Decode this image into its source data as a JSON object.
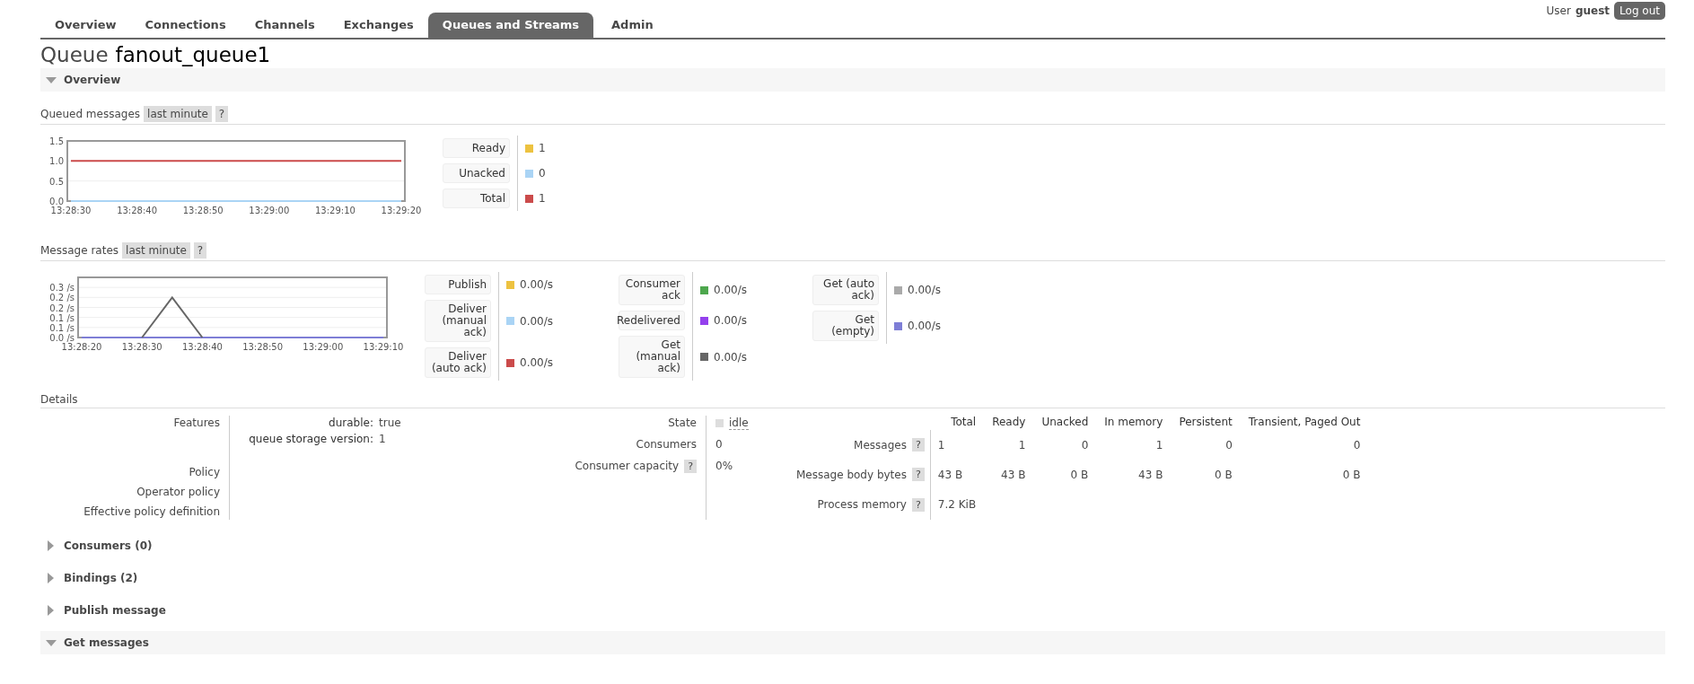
{
  "user": {
    "label": "User",
    "name": "guest",
    "logout": "Log out"
  },
  "tabs": [
    {
      "label": "Overview",
      "selected": false
    },
    {
      "label": "Connections",
      "selected": false
    },
    {
      "label": "Channels",
      "selected": false
    },
    {
      "label": "Exchanges",
      "selected": false
    },
    {
      "label": "Queues and Streams",
      "selected": true
    },
    {
      "label": "Admin",
      "selected": false
    }
  ],
  "title": {
    "prefix": "Queue",
    "name": "fanout_queue1"
  },
  "overview": {
    "title": "Overview",
    "expanded": true
  },
  "queued_messages": {
    "title": "Queued messages",
    "range": "last minute",
    "help": "?",
    "chart_data": {
      "type": "line",
      "categories": [
        "13:28:30",
        "13:28:40",
        "13:28:50",
        "13:29:00",
        "13:29:10",
        "13:29:20"
      ],
      "ylim": [
        0,
        1.5
      ],
      "yticks": [
        {
          "value": 0,
          "label": "0.0"
        },
        {
          "value": 0.5,
          "label": "0.5"
        },
        {
          "value": 1,
          "label": "1.0"
        },
        {
          "value": 1.5,
          "label": "1.5"
        }
      ],
      "grid": true,
      "series": [
        {
          "name": "Ready",
          "color": "#edc240",
          "values": [
            null,
            null,
            null,
            null,
            null,
            null
          ]
        },
        {
          "name": "Unacked",
          "color": "#aad4f5",
          "values": [
            0,
            0,
            0,
            0,
            0,
            0
          ]
        },
        {
          "name": "Total",
          "color": "#cb4b4b",
          "values": [
            1,
            1,
            1,
            1,
            1,
            1
          ]
        }
      ]
    },
    "legend_columns": [
      [
        {
          "value": "1"
        },
        {
          "value": "0"
        },
        {
          "value": "1"
        }
      ]
    ]
  },
  "message_rates": {
    "title": "Message rates",
    "range": "last minute",
    "help": "?",
    "chart_data": {
      "type": "line",
      "categories": [
        "13:28:20",
        null,
        "13:28:30",
        null,
        "13:28:40",
        null,
        "13:28:50",
        null,
        "13:29:00",
        null,
        "13:29:10"
      ],
      "ylim": [
        0,
        0.3
      ],
      "yticks": [
        {
          "value": 0,
          "label": "0.0 /s"
        },
        {
          "value": 0.05,
          "label": "0.1 /s"
        },
        {
          "value": 0.1,
          "label": "0.1 /s"
        },
        {
          "value": 0.15,
          "label": "0.2 /s"
        },
        {
          "value": 0.2,
          "label": "0.2 /s"
        },
        {
          "value": 0.25,
          "label": "0.3 /s"
        }
      ],
      "grid": true,
      "series": [
        {
          "name": "Publish",
          "color": "#edc240",
          "values": [
            null,
            null,
            null,
            null,
            null,
            null,
            null,
            null,
            null,
            null,
            null
          ]
        },
        {
          "name": "Deliver (manual ack)",
          "color": "#aad4f5",
          "values": [
            null,
            null,
            null,
            null,
            null,
            null,
            null,
            null,
            null,
            null,
            null
          ]
        },
        {
          "name": "Deliver (auto ack)",
          "color": "#cb4b4b",
          "values": [
            null,
            null,
            null,
            null,
            null,
            null,
            null,
            null,
            null,
            null,
            null
          ]
        },
        {
          "name": "Consumer ack",
          "color": "#4da74d",
          "values": [
            null,
            null,
            null,
            null,
            null,
            null,
            null,
            null,
            null,
            null,
            null
          ]
        },
        {
          "name": "Redelivered",
          "color": "#9440ed",
          "values": [
            null,
            null,
            null,
            null,
            null,
            null,
            null,
            null,
            null,
            null,
            null
          ]
        },
        {
          "name": "Get (manual ack)",
          "color": "#666666",
          "values": [
            null,
            null,
            0,
            0.2,
            0,
            null,
            null,
            null,
            null,
            null,
            null
          ]
        },
        {
          "name": "Get (auto ack)",
          "color": "#aaaaaa",
          "values": [
            null,
            null,
            null,
            null,
            null,
            null,
            null,
            null,
            null,
            null,
            null
          ]
        },
        {
          "name": "Get (empty)",
          "color": "#7e7ed6",
          "values": [
            0,
            0,
            0,
            0,
            0,
            0,
            0,
            0,
            0,
            0,
            0
          ]
        }
      ]
    },
    "legend_columns": [
      [
        {
          "value": "0.00/s"
        },
        {
          "value": "0.00/s"
        },
        {
          "value": "0.00/s"
        }
      ],
      [
        {
          "value": "0.00/s"
        },
        {
          "value": "0.00/s"
        },
        {
          "value": "0.00/s"
        }
      ],
      [
        {
          "value": "0.00/s"
        },
        {
          "value": "0.00/s"
        }
      ]
    ]
  },
  "details": {
    "title": "Details",
    "features_label": "Features",
    "features": [
      {
        "key": "durable:",
        "value": "true"
      },
      {
        "key": "queue storage version:",
        "value": "1"
      }
    ],
    "policy_labels": [
      "Policy",
      "Operator policy",
      "Effective policy definition"
    ],
    "state": {
      "label": "State",
      "value": "idle"
    },
    "consumers": {
      "label": "Consumers",
      "value": "0"
    },
    "capacity": {
      "label": "Consumer capacity",
      "help": "?",
      "value": "0%"
    },
    "columns": [
      "Total",
      "Ready",
      "Unacked",
      "In memory",
      "Persistent",
      "Transient, Paged Out"
    ],
    "rows": [
      {
        "label": "Messages",
        "help": "?",
        "cells": [
          "1",
          "1",
          "0",
          "1",
          "0",
          "0"
        ]
      },
      {
        "label": "Message body bytes",
        "help": "?",
        "cells": [
          "43 B",
          "43 B",
          "0 B",
          "43 B",
          "0 B",
          "0 B"
        ]
      },
      {
        "label": "Process memory",
        "help": "?",
        "cells": [
          "7.2 KiB"
        ]
      }
    ]
  },
  "sections": [
    {
      "title": "Consumers (0)",
      "expanded": false
    },
    {
      "title": "Bindings (2)",
      "expanded": false
    },
    {
      "title": "Publish message",
      "expanded": false
    },
    {
      "title": "Get messages",
      "expanded": true
    }
  ]
}
